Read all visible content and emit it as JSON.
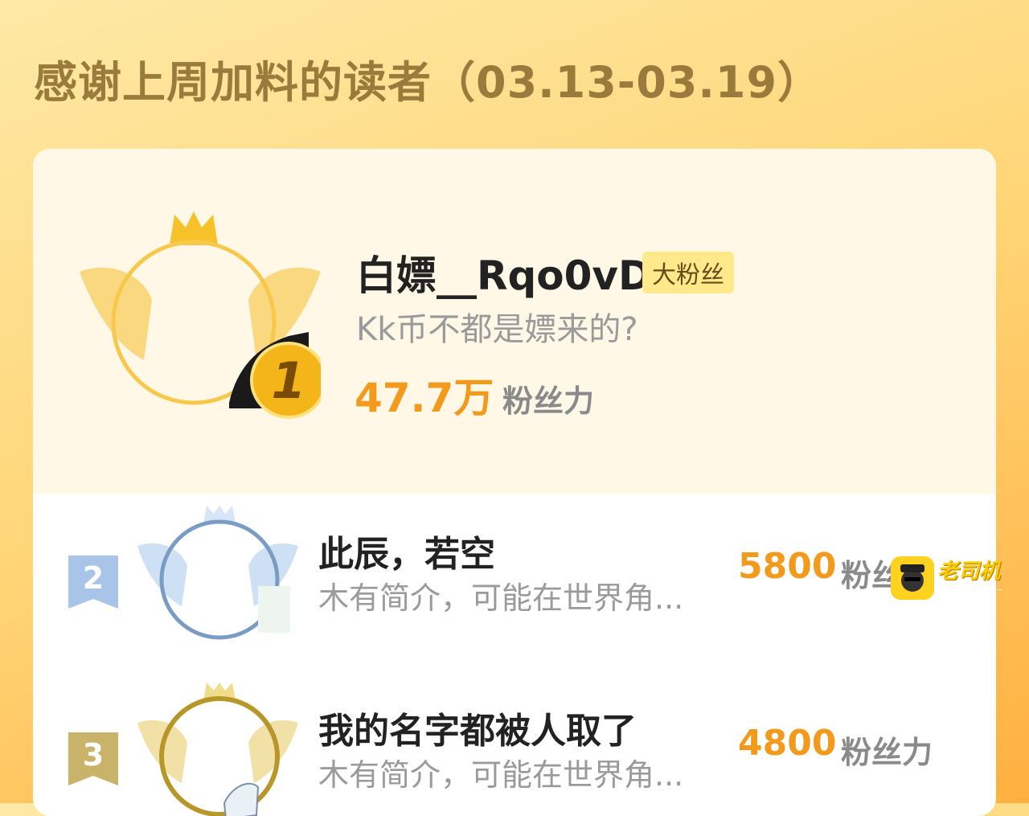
{
  "header": {
    "title": "感谢上周加料的读者（03.13-03.19）"
  },
  "first": {
    "rank": "1",
    "name": "白嫖__Rqo0vD",
    "badge": "大粉丝",
    "bio": "Kk币不都是嫖来的?",
    "fans_value": "47.7万",
    "fans_label": "粉丝力"
  },
  "rows": [
    {
      "rank": "2",
      "name": "此辰，若空",
      "bio": "木有简介，可能在世界角...",
      "fans_value": "5800",
      "fans_label": "粉丝力"
    },
    {
      "rank": "3",
      "name": "我的名字都被人取了",
      "bio": "木有简介，可能在世界角...",
      "fans_value": "4800",
      "fans_label": "粉丝力"
    }
  ],
  "watermark": {
    "text": "老司机",
    "sub": "- lsjmh.vip -"
  },
  "colors": {
    "accent": "#f39a1c",
    "gold": "#f7b92a",
    "silver_blue": "#7a9cc4",
    "bronze": "#b8972a",
    "title": "#9a7b3b"
  }
}
